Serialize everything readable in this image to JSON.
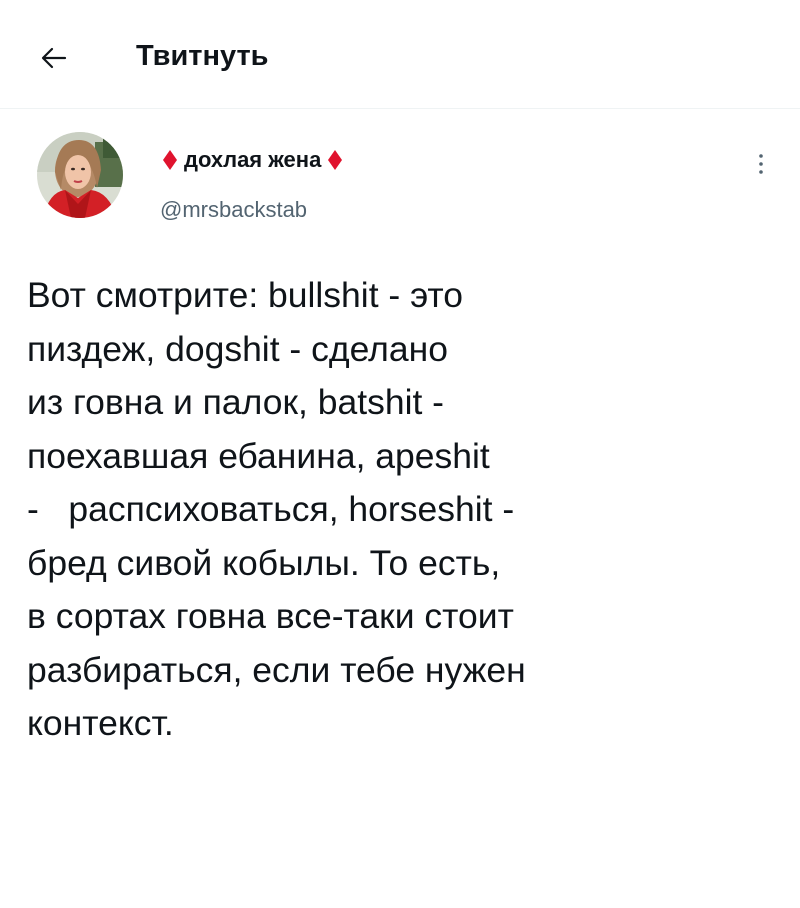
{
  "header": {
    "title": "Твитнуть",
    "back_icon": "arrow-left-icon"
  },
  "tweet": {
    "author": {
      "display_name": "дохлая жена",
      "handle": "@mrsbackstab",
      "name_decoration_icon": "red-diamond-icon",
      "decoration_color": "#e0132e"
    },
    "more_icon": "more-vertical-icon",
    "text_lines": [
      "Вот смотрите: bullshit - это",
      "пиздеж, dogshit - сделано",
      "из говна и палок, batshit -",
      "поехавшая ебанина, apeshit",
      "-   распсиховаться, horseshit -",
      "бред сивой кобылы. То есть,",
      "в сортах говна все-таки стоит",
      "разбираться, если тебе нужен",
      "контекст."
    ]
  },
  "colors": {
    "text_primary": "#0f1419",
    "text_secondary": "#536471",
    "divider": "#eff3f4"
  }
}
